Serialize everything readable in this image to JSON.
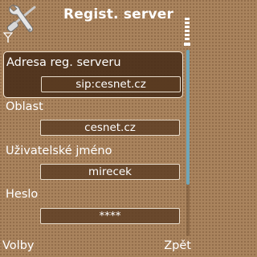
{
  "header": {
    "title": "Regist. server",
    "icon": "wrench-screwdriver-icon"
  },
  "status": {
    "signal_icon": "antenna-signal-icon",
    "battery_icon": "battery-bars-icon"
  },
  "fields": [
    {
      "label": "Adresa reg. serveru",
      "value": "sip:cesnet.cz",
      "selected": true
    },
    {
      "label": "Oblast",
      "value": "cesnet.cz",
      "selected": false
    },
    {
      "label": "Uživatelské jméno",
      "value": "mirecek",
      "selected": false
    },
    {
      "label": "Heslo",
      "value": "****",
      "selected": false
    }
  ],
  "softkeys": {
    "left": "Volby",
    "right": "Zpět"
  },
  "colors": {
    "background": "#a9835d",
    "highlight": "#482c18",
    "scroll_thumb": "#6fa6b8",
    "text": "#ffffff"
  }
}
